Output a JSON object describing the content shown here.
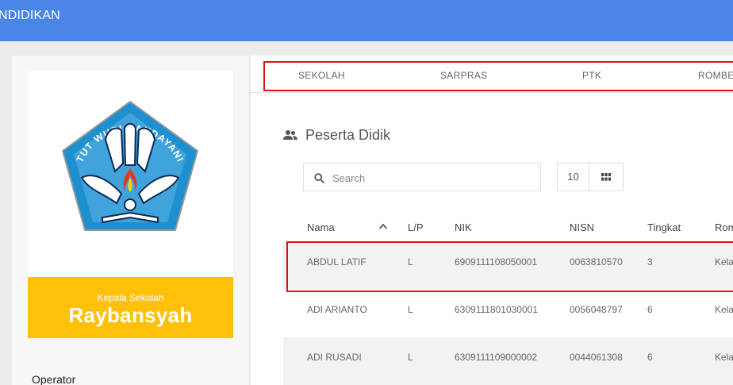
{
  "header": {
    "title": "NDIDIKAN"
  },
  "sidebar": {
    "logo_text": "TUT WURI HANDAYANI",
    "role_label": "Kepala Sekolah",
    "principal_name": "Raybansyah",
    "operator_label": "Operator"
  },
  "tabs": [
    {
      "label": "SEKOLAH"
    },
    {
      "label": "SARPRAS"
    },
    {
      "label": "PTK"
    },
    {
      "label": "ROMBE"
    }
  ],
  "section": {
    "title": "Peserta Didik"
  },
  "search": {
    "placeholder": "Search"
  },
  "pagination": {
    "per_page": "10"
  },
  "table": {
    "columns": [
      "Nama",
      "L/P",
      "NIK",
      "NISN",
      "Tingkat",
      "Rom"
    ],
    "rows": [
      [
        "ABDUL LATIF",
        "L",
        "6909111108050001",
        "0063810570",
        "3",
        "Kela"
      ],
      [
        "ADI ARIANTO",
        "L",
        "6309111801030001",
        "0056048797",
        "6",
        "Kela"
      ],
      [
        "ADI RUSADI",
        "L",
        "6309111109000002",
        "0044061308",
        "6",
        "Kela"
      ]
    ]
  },
  "colors": {
    "header": "#4a86e8",
    "principal_card": "#fec107",
    "highlight": "#e01010",
    "logo_blue": "#1e8fcf"
  }
}
